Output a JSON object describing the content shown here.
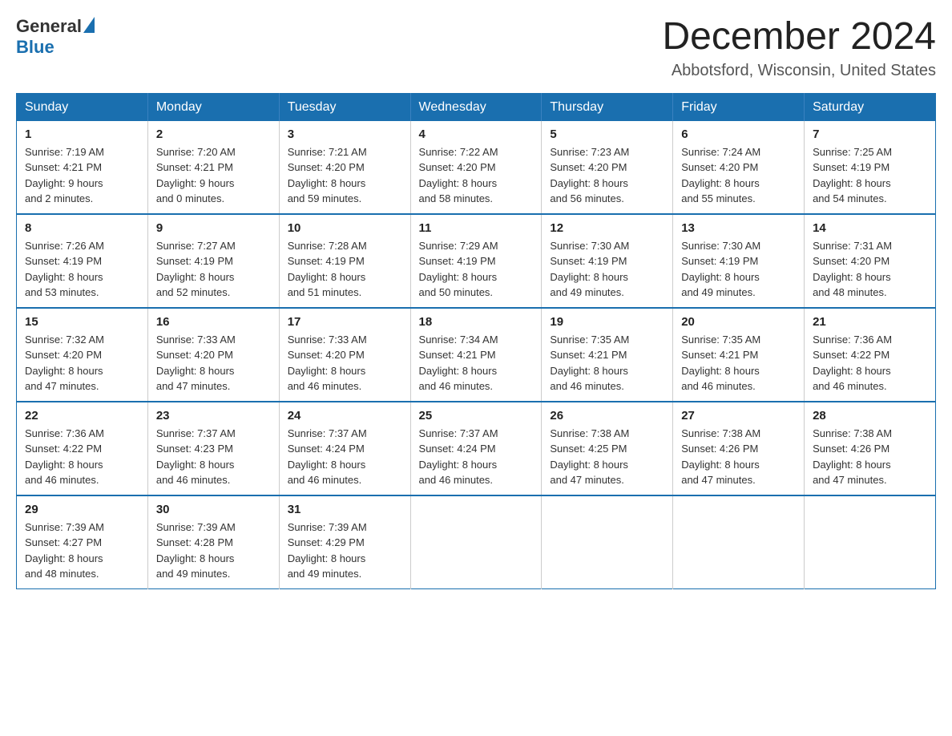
{
  "logo": {
    "general": "General",
    "blue": "Blue"
  },
  "title": "December 2024",
  "location": "Abbotsford, Wisconsin, United States",
  "weekdays": [
    "Sunday",
    "Monday",
    "Tuesday",
    "Wednesday",
    "Thursday",
    "Friday",
    "Saturday"
  ],
  "weeks": [
    [
      {
        "day": "1",
        "sunrise": "7:19 AM",
        "sunset": "4:21 PM",
        "daylight": "9 hours and 2 minutes."
      },
      {
        "day": "2",
        "sunrise": "7:20 AM",
        "sunset": "4:21 PM",
        "daylight": "9 hours and 0 minutes."
      },
      {
        "day": "3",
        "sunrise": "7:21 AM",
        "sunset": "4:20 PM",
        "daylight": "8 hours and 59 minutes."
      },
      {
        "day": "4",
        "sunrise": "7:22 AM",
        "sunset": "4:20 PM",
        "daylight": "8 hours and 58 minutes."
      },
      {
        "day": "5",
        "sunrise": "7:23 AM",
        "sunset": "4:20 PM",
        "daylight": "8 hours and 56 minutes."
      },
      {
        "day": "6",
        "sunrise": "7:24 AM",
        "sunset": "4:20 PM",
        "daylight": "8 hours and 55 minutes."
      },
      {
        "day": "7",
        "sunrise": "7:25 AM",
        "sunset": "4:19 PM",
        "daylight": "8 hours and 54 minutes."
      }
    ],
    [
      {
        "day": "8",
        "sunrise": "7:26 AM",
        "sunset": "4:19 PM",
        "daylight": "8 hours and 53 minutes."
      },
      {
        "day": "9",
        "sunrise": "7:27 AM",
        "sunset": "4:19 PM",
        "daylight": "8 hours and 52 minutes."
      },
      {
        "day": "10",
        "sunrise": "7:28 AM",
        "sunset": "4:19 PM",
        "daylight": "8 hours and 51 minutes."
      },
      {
        "day": "11",
        "sunrise": "7:29 AM",
        "sunset": "4:19 PM",
        "daylight": "8 hours and 50 minutes."
      },
      {
        "day": "12",
        "sunrise": "7:30 AM",
        "sunset": "4:19 PM",
        "daylight": "8 hours and 49 minutes."
      },
      {
        "day": "13",
        "sunrise": "7:30 AM",
        "sunset": "4:19 PM",
        "daylight": "8 hours and 49 minutes."
      },
      {
        "day": "14",
        "sunrise": "7:31 AM",
        "sunset": "4:20 PM",
        "daylight": "8 hours and 48 minutes."
      }
    ],
    [
      {
        "day": "15",
        "sunrise": "7:32 AM",
        "sunset": "4:20 PM",
        "daylight": "8 hours and 47 minutes."
      },
      {
        "day": "16",
        "sunrise": "7:33 AM",
        "sunset": "4:20 PM",
        "daylight": "8 hours and 47 minutes."
      },
      {
        "day": "17",
        "sunrise": "7:33 AM",
        "sunset": "4:20 PM",
        "daylight": "8 hours and 46 minutes."
      },
      {
        "day": "18",
        "sunrise": "7:34 AM",
        "sunset": "4:21 PM",
        "daylight": "8 hours and 46 minutes."
      },
      {
        "day": "19",
        "sunrise": "7:35 AM",
        "sunset": "4:21 PM",
        "daylight": "8 hours and 46 minutes."
      },
      {
        "day": "20",
        "sunrise": "7:35 AM",
        "sunset": "4:21 PM",
        "daylight": "8 hours and 46 minutes."
      },
      {
        "day": "21",
        "sunrise": "7:36 AM",
        "sunset": "4:22 PM",
        "daylight": "8 hours and 46 minutes."
      }
    ],
    [
      {
        "day": "22",
        "sunrise": "7:36 AM",
        "sunset": "4:22 PM",
        "daylight": "8 hours and 46 minutes."
      },
      {
        "day": "23",
        "sunrise": "7:37 AM",
        "sunset": "4:23 PM",
        "daylight": "8 hours and 46 minutes."
      },
      {
        "day": "24",
        "sunrise": "7:37 AM",
        "sunset": "4:24 PM",
        "daylight": "8 hours and 46 minutes."
      },
      {
        "day": "25",
        "sunrise": "7:37 AM",
        "sunset": "4:24 PM",
        "daylight": "8 hours and 46 minutes."
      },
      {
        "day": "26",
        "sunrise": "7:38 AM",
        "sunset": "4:25 PM",
        "daylight": "8 hours and 47 minutes."
      },
      {
        "day": "27",
        "sunrise": "7:38 AM",
        "sunset": "4:26 PM",
        "daylight": "8 hours and 47 minutes."
      },
      {
        "day": "28",
        "sunrise": "7:38 AM",
        "sunset": "4:26 PM",
        "daylight": "8 hours and 47 minutes."
      }
    ],
    [
      {
        "day": "29",
        "sunrise": "7:39 AM",
        "sunset": "4:27 PM",
        "daylight": "8 hours and 48 minutes."
      },
      {
        "day": "30",
        "sunrise": "7:39 AM",
        "sunset": "4:28 PM",
        "daylight": "8 hours and 49 minutes."
      },
      {
        "day": "31",
        "sunrise": "7:39 AM",
        "sunset": "4:29 PM",
        "daylight": "8 hours and 49 minutes."
      },
      null,
      null,
      null,
      null
    ]
  ],
  "labels": {
    "sunrise": "Sunrise:",
    "sunset": "Sunset:",
    "daylight": "Daylight:"
  }
}
